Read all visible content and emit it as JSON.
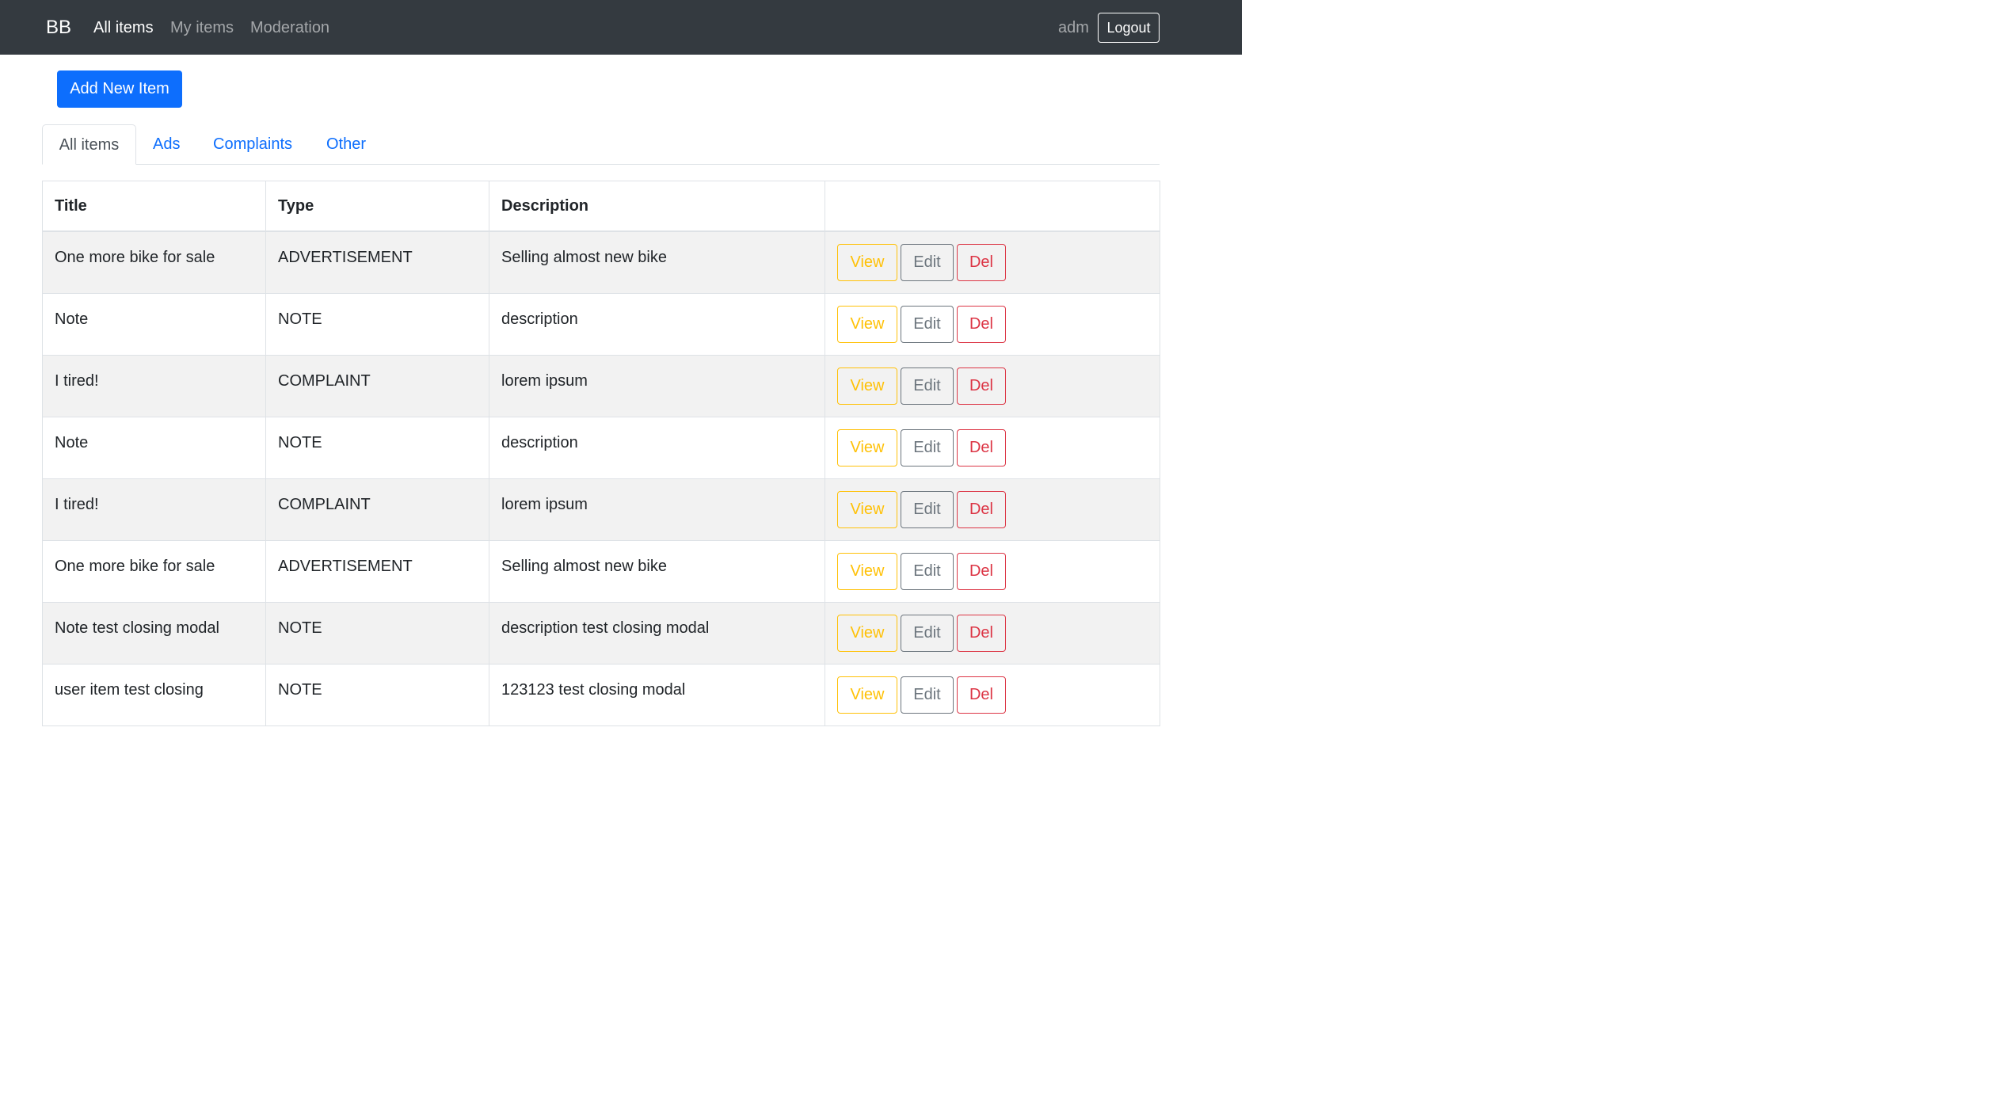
{
  "navbar": {
    "brand": "BB",
    "links": [
      {
        "label": "All items",
        "active": true
      },
      {
        "label": "My items",
        "active": false
      },
      {
        "label": "Moderation",
        "active": false
      }
    ],
    "user": "adm",
    "logout_label": "Logout"
  },
  "add_button_label": "Add New Item",
  "tabs": [
    {
      "label": "All items",
      "active": true
    },
    {
      "label": "Ads",
      "active": false
    },
    {
      "label": "Complaints",
      "active": false
    },
    {
      "label": "Other",
      "active": false
    }
  ],
  "table": {
    "headers": [
      "Title",
      "Type",
      "Description",
      ""
    ],
    "action_labels": {
      "view": "View",
      "edit": "Edit",
      "del": "Del"
    },
    "rows": [
      {
        "title": "One more bike for sale",
        "type": "ADVERTISEMENT",
        "description": "Selling almost new bike"
      },
      {
        "title": "Note",
        "type": "NOTE",
        "description": "description"
      },
      {
        "title": "I tired!",
        "type": "COMPLAINT",
        "description": "lorem ipsum"
      },
      {
        "title": "Note",
        "type": "NOTE",
        "description": "description"
      },
      {
        "title": "I tired!",
        "type": "COMPLAINT",
        "description": "lorem ipsum"
      },
      {
        "title": "One more bike for sale",
        "type": "ADVERTISEMENT",
        "description": "Selling almost new bike"
      },
      {
        "title": "Note test closing modal",
        "type": "NOTE",
        "description": "description test closing modal"
      },
      {
        "title": "user item test closing",
        "type": "NOTE",
        "description": "123123 test closing modal"
      }
    ]
  },
  "colors": {
    "navbar_bg": "#343a40",
    "primary": "#0d6efd",
    "warning": "#ffc107",
    "secondary": "#6c757d",
    "danger": "#dc3545"
  }
}
